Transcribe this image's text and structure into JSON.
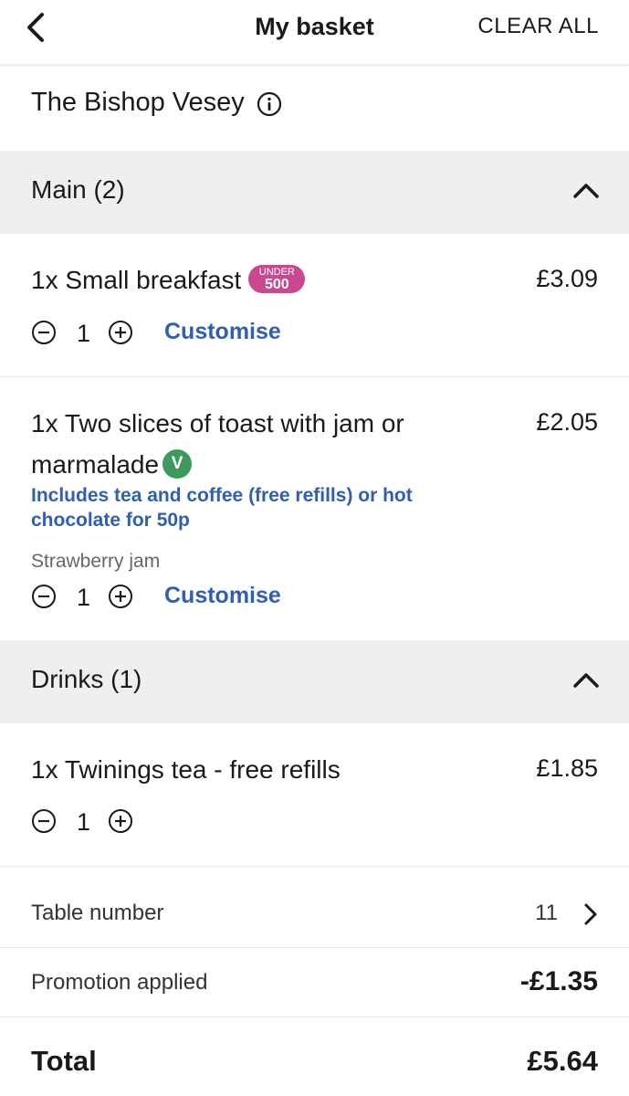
{
  "header": {
    "title": "My basket",
    "clear_all": "CLEAR ALL",
    "back_icon": "chevron-left-icon"
  },
  "venue": {
    "name": "The Bishop Vesey",
    "info_icon": "info-icon"
  },
  "sections": [
    {
      "title": "Main (2)",
      "items": [
        {
          "name": "1x Small breakfast",
          "price": "£3.09",
          "badge": {
            "top": "UNDER",
            "number": "500",
            "color": "#c9498f"
          },
          "quantity": "1",
          "customise_label": "Customise"
        },
        {
          "name_line1": "1x Two slices of toast with jam or",
          "name_line2": "marmalade",
          "price": "£2.05",
          "veg_badge": "V",
          "description": "Includes tea and coffee (free refills) or hot chocolate for 50p",
          "option": "Strawberry jam",
          "quantity": "1",
          "customise_label": "Customise"
        }
      ]
    },
    {
      "title": "Drinks (1)",
      "items": [
        {
          "name": "1x Twinings tea - free refills",
          "price": "£1.85",
          "quantity": "1"
        }
      ]
    }
  ],
  "table": {
    "label": "Table number",
    "value": "11"
  },
  "promotion": {
    "label": "Promotion applied",
    "value": "-£1.35"
  },
  "total": {
    "label": "Total",
    "value": "£5.64"
  },
  "colors": {
    "accent_blue": "#2f5fb3",
    "section_bg": "#efefef",
    "veg_green": "#3c9a5f",
    "badge_pink": "#c9498f"
  }
}
